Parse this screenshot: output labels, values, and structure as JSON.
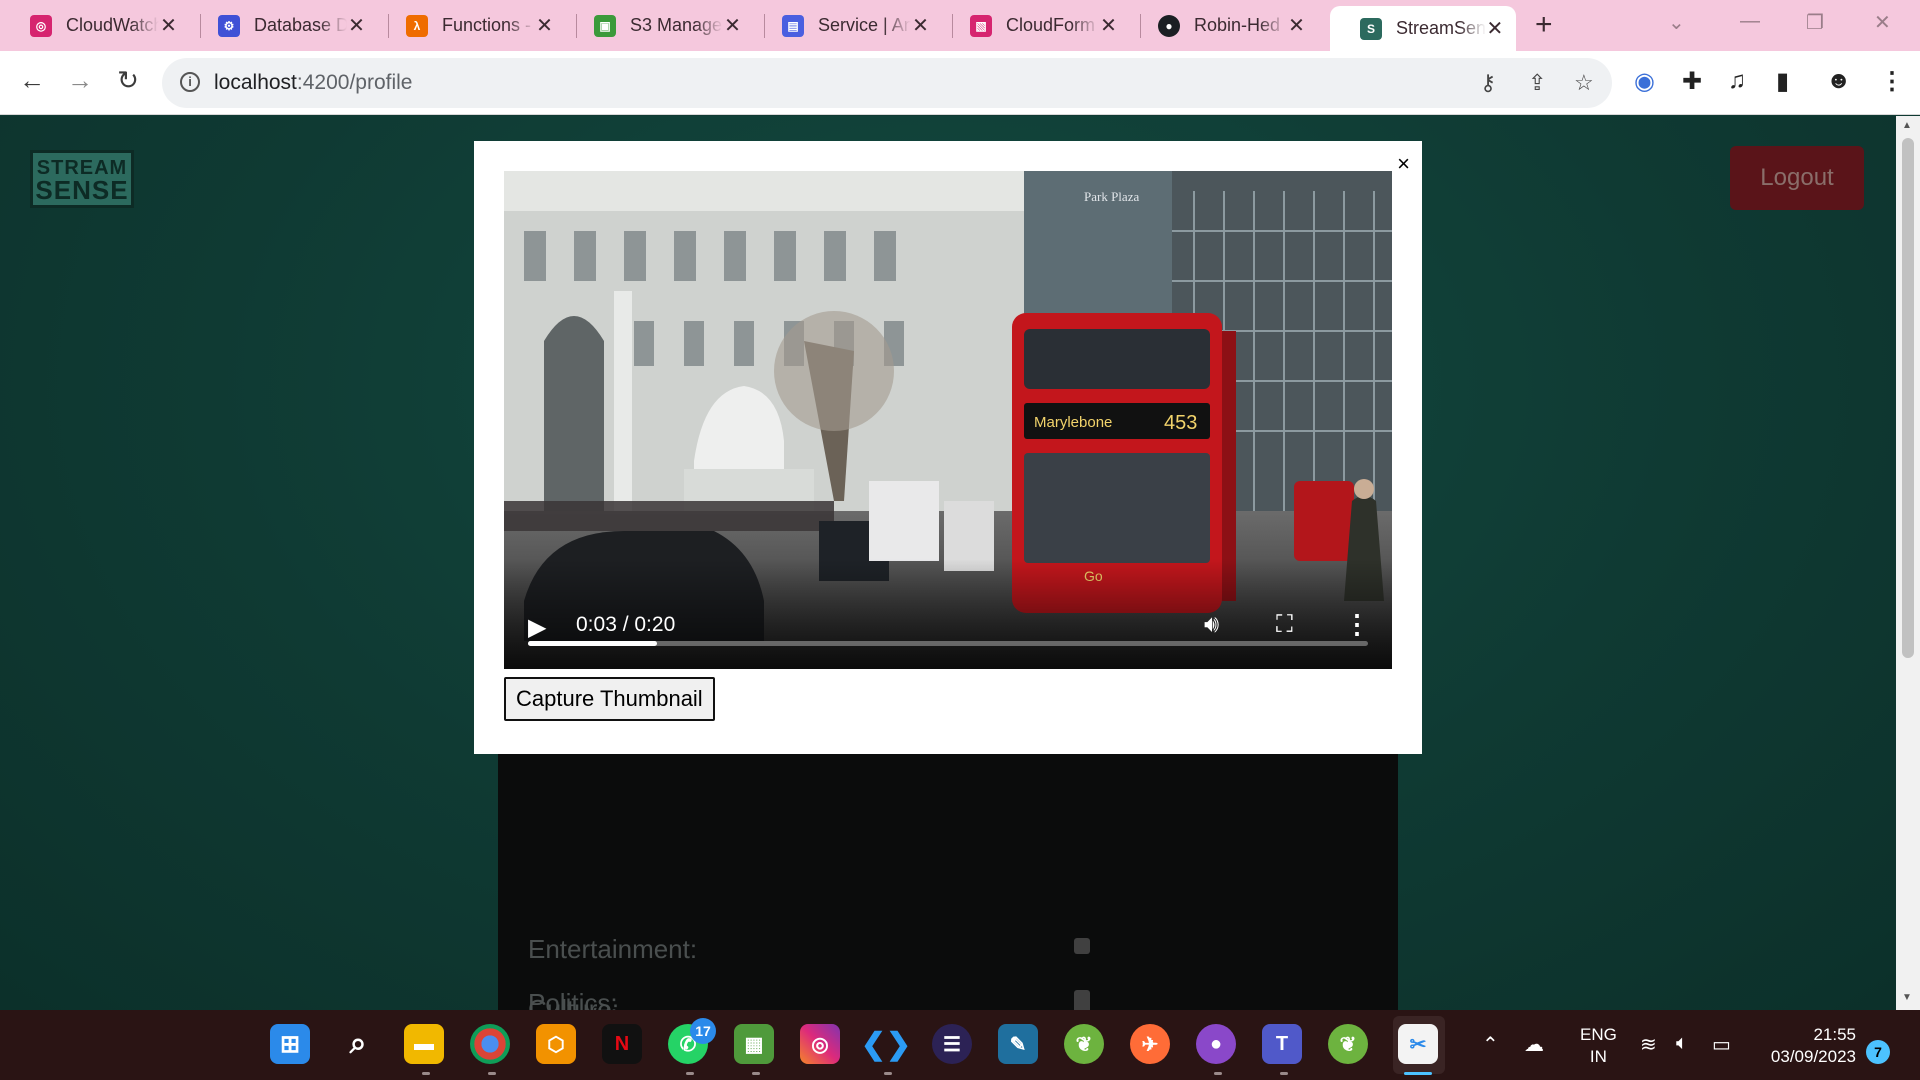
{
  "browser": {
    "tabs": [
      {
        "label": "CloudWatch",
        "fav_color": "#d6246f",
        "fav_glyph": "◎"
      },
      {
        "label": "Database D",
        "fav_color": "#3f51d6",
        "fav_glyph": "⚙"
      },
      {
        "label": "Functions -",
        "fav_color": "#ef6c00",
        "fav_glyph": "λ"
      },
      {
        "label": "S3 Manage",
        "fav_color": "#3b9a3b",
        "fav_glyph": "▣"
      },
      {
        "label": "Service | An",
        "fav_color": "#4a5fe0",
        "fav_glyph": "▤"
      },
      {
        "label": "CloudForm",
        "fav_color": "#d6246f",
        "fav_glyph": "▧"
      },
      {
        "label": "Robin-Hed",
        "fav_color": "#1b1f23",
        "fav_glyph": "●"
      },
      {
        "label": "StreamSens",
        "fav_color": "#2c6a5e",
        "fav_glyph": "S"
      }
    ],
    "url_host": "localhost",
    "url_path": ":4200/profile"
  },
  "page": {
    "logo_line1": "STREAM",
    "logo_line2": "SENSE",
    "logout_label": "Logout",
    "preferences": [
      {
        "label": "Politics:"
      },
      {
        "label": "Entertainment:"
      },
      {
        "label": "Culture:"
      }
    ]
  },
  "modal": {
    "close_label": "×",
    "video": {
      "current_time": "0:03",
      "duration": "0:20",
      "time_display": "0:03 / 0:20",
      "progress": 0.154,
      "bus_destination": "Marylebone",
      "bus_route": "453",
      "bus_brand": "Go",
      "building_sign": "Park Plaza"
    },
    "capture_label": "Capture Thumbnail"
  },
  "taskbar": {
    "whatsapp_badge": "17",
    "lang_line1": "ENG",
    "lang_line2": "IN",
    "time": "21:55",
    "date": "03/09/2023",
    "notification_count": "7"
  }
}
